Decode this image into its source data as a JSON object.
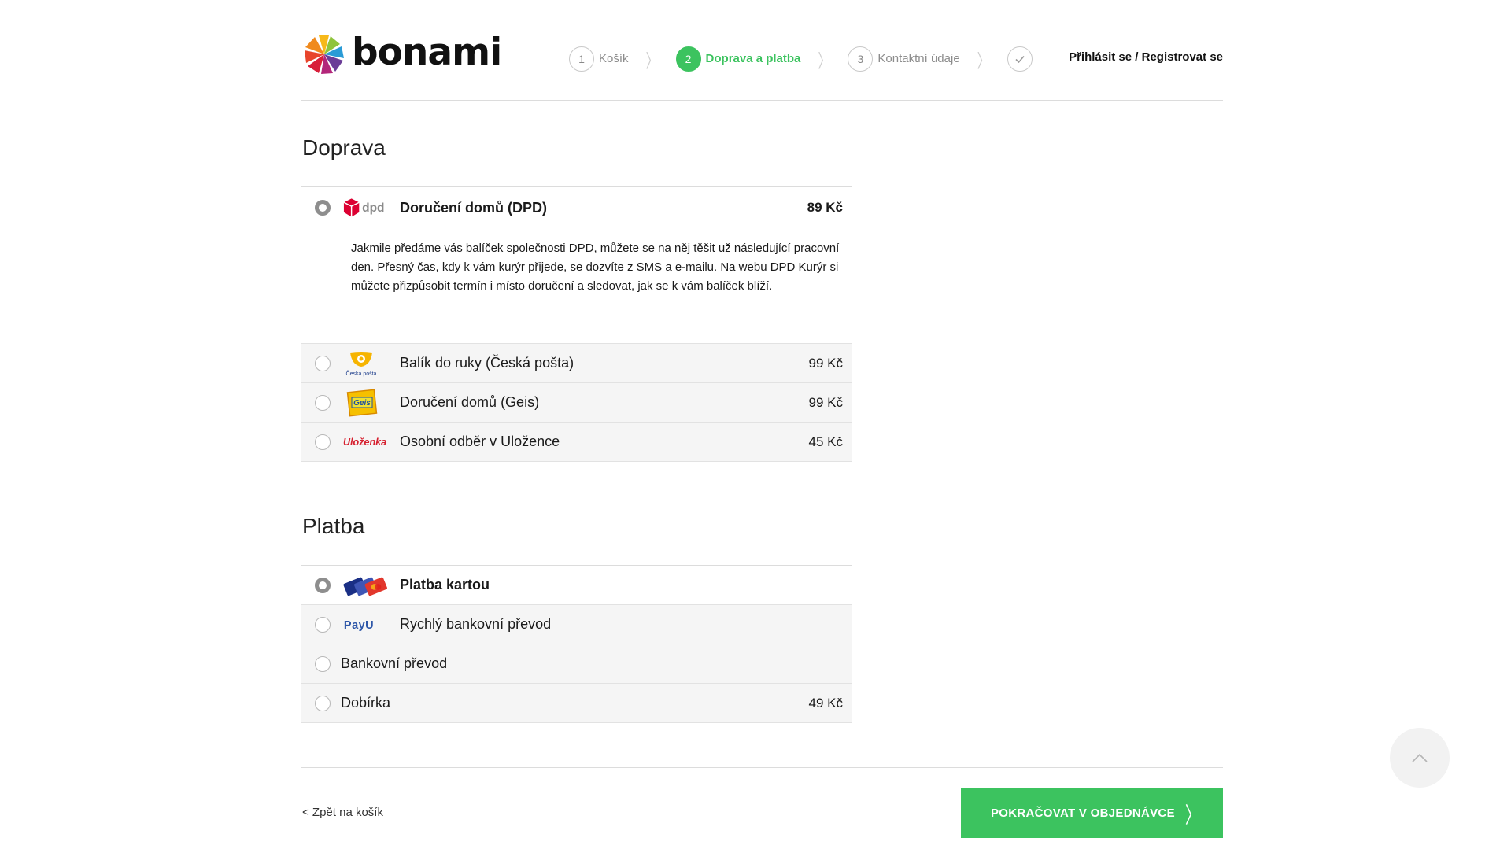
{
  "brand": {
    "name": "bonami",
    "accent": "#3cc35f"
  },
  "steps": [
    {
      "num": "1",
      "label": "Košík",
      "state": "done"
    },
    {
      "num": "2",
      "label": "Doprava a platba",
      "state": "active"
    },
    {
      "num": "3",
      "label": "Kontaktní údaje",
      "state": "pending"
    },
    {
      "num": "",
      "label": "",
      "icon": "check-icon",
      "state": "pending"
    }
  ],
  "auth": {
    "login": "Přihlásit se",
    "divider": " / ",
    "register": "Registrovat se"
  },
  "shipping": {
    "heading": "Doprava",
    "options": [
      {
        "logo": "dpd",
        "name": "Doručení domů (DPD)",
        "price": "89 Kč",
        "selected": true,
        "description": "Jakmile předáme vás balíček společnosti DPD, můžete se na něj těšit už následující pracovní den. Přesný čas, kdy k vám kurýr přijede, se dozvíte z SMS a e-mailu. Na webu DPD Kurýr si můžete přizpůsobit termín i místo doručení a sledovat, jak se k vám balíček blíží."
      },
      {
        "logo": "ceska-posta",
        "logo_caption": "Česká pošta",
        "name": "Balík do ruky (Česká pošta)",
        "price": "99 Kč",
        "selected": false
      },
      {
        "logo": "geis",
        "logo_caption": "Geis",
        "name": "Doručení domů (Geis)",
        "price": "99 Kč",
        "selected": false
      },
      {
        "logo": "ulozenka",
        "logo_caption": "Uloženka",
        "name": "Osobní odběr v Uložence",
        "price": "45 Kč",
        "selected": false
      }
    ]
  },
  "payment": {
    "heading": "Platba",
    "options": [
      {
        "logo": "cards",
        "name": "Platba kartou",
        "price": "",
        "selected": true
      },
      {
        "logo": "payu",
        "logo_caption": "PayU",
        "name": "Rychlý bankovní převod",
        "price": "",
        "selected": false
      },
      {
        "logo": "",
        "name": "Bankovní převod",
        "price": "",
        "selected": false
      },
      {
        "logo": "",
        "name": "Dobírka",
        "price": "49 Kč",
        "selected": false
      }
    ]
  },
  "footer": {
    "back": "< Zpět na košík",
    "continue": "POKRAČOVAT V OBJEDNÁVCE",
    "continue_icon": "chevron-right-icon"
  },
  "scroll_top_icon": "chevron-up-icon",
  "logo_text": {
    "dpd": "dpd"
  }
}
